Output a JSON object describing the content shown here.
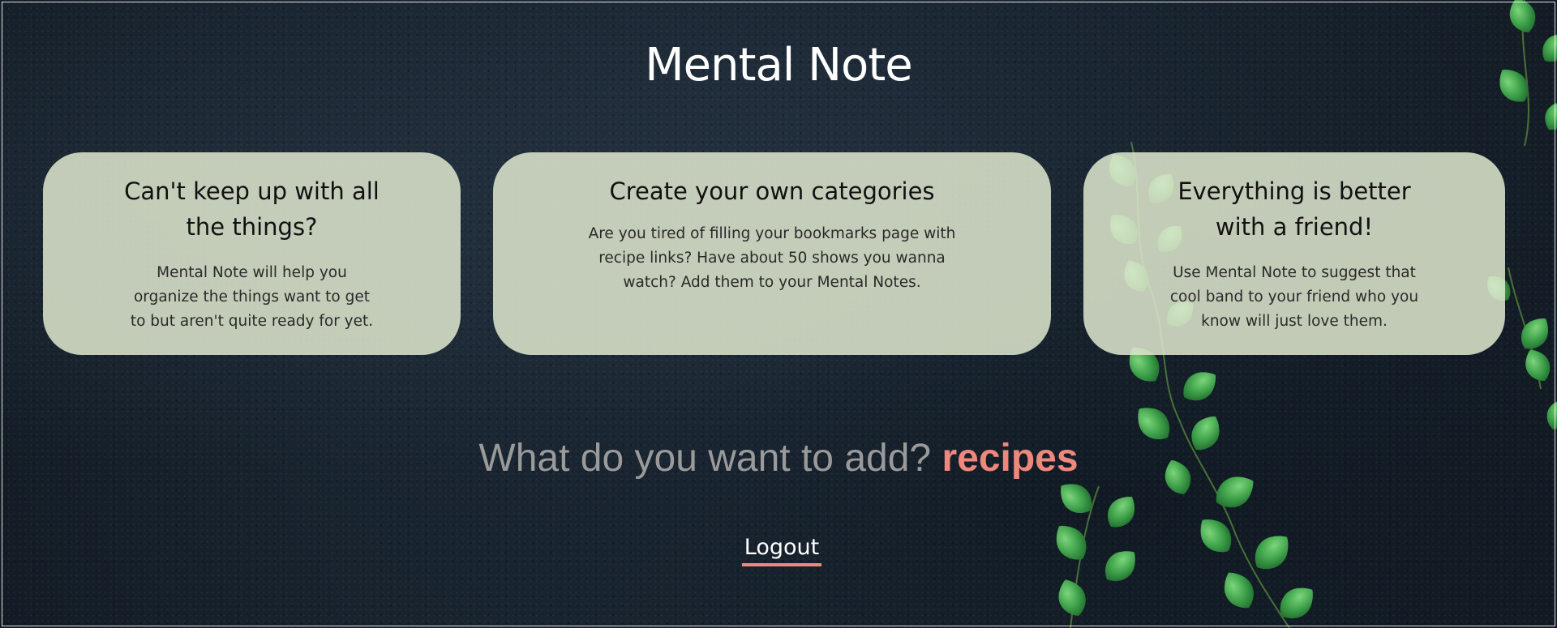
{
  "app": {
    "title": "Mental Note"
  },
  "cards": [
    {
      "heading": "Can't keep up with all the things?",
      "body": "Mental Note will help you organize the things want to get to but aren't quite ready for yet."
    },
    {
      "heading": "Create your own categories",
      "body": "Are you tired of filling your bookmarks page with recipe links? Have about 50 shows you wanna watch? Add them to your Mental Notes."
    },
    {
      "heading": "Everything is better with a friend!",
      "body": "Use Mental Note to suggest that cool band to your friend who you know will just love them."
    }
  ],
  "prompt": {
    "text": "What do you want to add?",
    "rotating_word": "recipes"
  },
  "actions": {
    "logout_label": "Logout"
  },
  "colors": {
    "accent": "#f0877c",
    "card_background": "#dee8ce",
    "background": "#1a2632",
    "leaf": "#3fa24b"
  },
  "decorations": {
    "background_image": "ivy-vines-on-dark-wall"
  }
}
